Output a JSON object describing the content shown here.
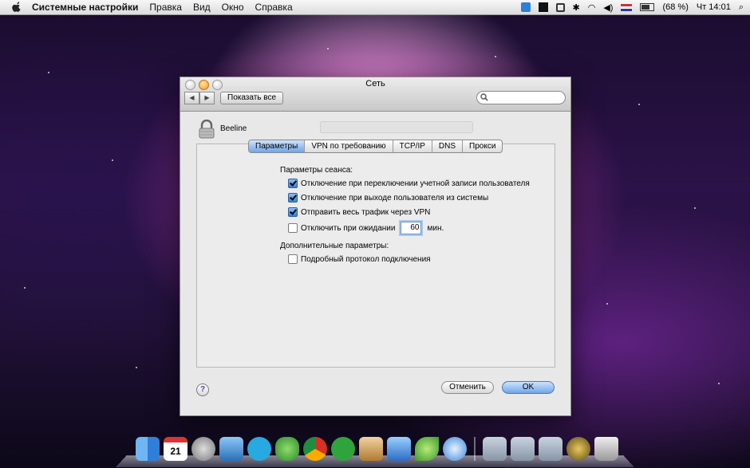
{
  "menubar": {
    "app_name": "Системные настройки",
    "items": [
      "Правка",
      "Вид",
      "Окно",
      "Справка"
    ],
    "battery": "(68 %)",
    "clock": "Чт 14:01"
  },
  "window": {
    "title": "Сеть",
    "show_all": "Показать все",
    "search_placeholder": "",
    "service_name": "Beeline",
    "tabs": [
      "Параметры",
      "VPN по требованию",
      "TCP/IP",
      "DNS",
      "Прокси"
    ],
    "active_tab": "Параметры",
    "session_section": "Параметры сеанса:",
    "options": [
      {
        "label": "Отключение при переключении учетной записи пользователя",
        "checked": true
      },
      {
        "label": "Отключение при выходе пользователя из системы",
        "checked": true
      },
      {
        "label": "Отправить весь трафик через VPN",
        "checked": true
      }
    ],
    "idle": {
      "label": "Отключить при ожидании",
      "value": "60",
      "unit": "мин.",
      "checked": false
    },
    "advanced_section": "Дополнительные параметры:",
    "verbose_log": {
      "label": "Подробный протокол подключения",
      "checked": false
    },
    "help_label": "?",
    "cancel_label": "Отменить",
    "ok_label": "OK"
  },
  "dock": {
    "icons": [
      "finder-icon",
      "ical-icon",
      "system-preferences-icon",
      "preview-icon",
      "skype-icon",
      "adium-icon",
      "chrome-icon",
      "utorrent-icon",
      "mail-icon",
      "xcode-icon",
      "leaf-icon",
      "safari-icon",
      "applications-folder-icon",
      "documents-folder-icon",
      "downloads-folder-icon",
      "quicktime-icon",
      "trash-icon"
    ],
    "calendar_day": "21"
  },
  "colors": {
    "accent": "#3a7fd8",
    "tab_active": "#6fa6ea"
  }
}
